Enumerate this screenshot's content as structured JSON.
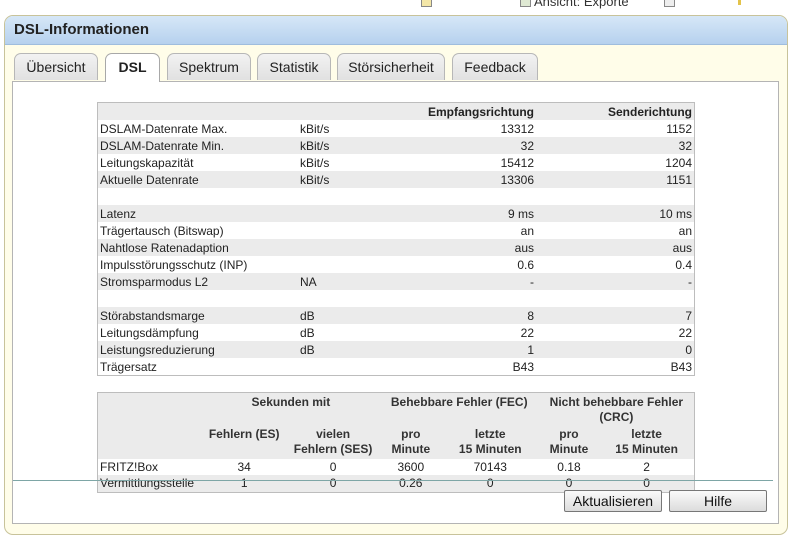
{
  "topbar": {
    "export_label": "Ansicht: Exporte"
  },
  "window": {
    "title": "DSL-Informationen"
  },
  "tabs": [
    {
      "label": "Übersicht"
    },
    {
      "label": "DSL"
    },
    {
      "label": "Spektrum"
    },
    {
      "label": "Statistik"
    },
    {
      "label": "Störsicherheit"
    },
    {
      "label": "Feedback"
    }
  ],
  "active_tab": "DSL",
  "info": {
    "headers": {
      "receive": "Empfangsrichtung",
      "send": "Senderichtung"
    },
    "rows": [
      {
        "label": "DSLAM-Datenrate Max.",
        "unit": "kBit/s",
        "receive": "13312",
        "send": "1152"
      },
      {
        "label": "DSLAM-Datenrate Min.",
        "unit": "kBit/s",
        "receive": "32",
        "send": "32"
      },
      {
        "label": "Leitungskapazität",
        "unit": "kBit/s",
        "receive": "15412",
        "send": "1204"
      },
      {
        "label": "Aktuelle Datenrate",
        "unit": "kBit/s",
        "receive": "13306",
        "send": "1151"
      },
      {
        "label": "Latenz",
        "unit": "",
        "receive": "9 ms",
        "send": "10 ms"
      },
      {
        "label": "Trägertausch (Bitswap)",
        "unit": "",
        "receive": "an",
        "send": "an"
      },
      {
        "label": "Nahtlose Ratenadaption",
        "unit": "",
        "receive": "aus",
        "send": "aus"
      },
      {
        "label": "Impulsstörungsschutz (INP)",
        "unit": "",
        "receive": "0.6",
        "send": "0.4"
      },
      {
        "label": "Stromsparmodus L2",
        "unit": "NA",
        "receive": "-",
        "send": "-"
      },
      {
        "label": "Störabstandsmarge",
        "unit": "dB",
        "receive": "8",
        "send": "7"
      },
      {
        "label": "Leitungsdämpfung",
        "unit": "dB",
        "receive": "22",
        "send": "22"
      },
      {
        "label": "Leistungsreduzierung",
        "unit": "dB",
        "receive": "1",
        "send": "0"
      },
      {
        "label": "Trägersatz",
        "unit": "",
        "receive": "B43",
        "send": "B43"
      }
    ]
  },
  "errors": {
    "group_headers": {
      "seconds": "Sekunden mit",
      "fec": "Behebbare Fehler (FEC)",
      "crc_line1": "Nicht behebbare Fehler",
      "crc_line2": "(CRC)"
    },
    "sub_headers": {
      "es": "Fehlern (ES)",
      "ses_line1": "vielen",
      "ses_line2": "Fehlern (SES)",
      "pro": "pro",
      "minute": "Minute",
      "letzte": "letzte",
      "fifteen": "15 Minuten"
    },
    "rows": [
      {
        "label": "FRITZ!Box",
        "es": "34",
        "ses": "0",
        "fec_min": "3600",
        "fec_15": "70143",
        "crc_min": "0.18",
        "crc_15": "2"
      },
      {
        "label": "Vermittlungsstelle",
        "es": "1",
        "ses": "0",
        "fec_min": "0.26",
        "fec_15": "0",
        "crc_min": "0",
        "crc_15": "0"
      }
    ]
  },
  "buttons": {
    "refresh": "Aktualisieren",
    "help": "Hilfe"
  }
}
